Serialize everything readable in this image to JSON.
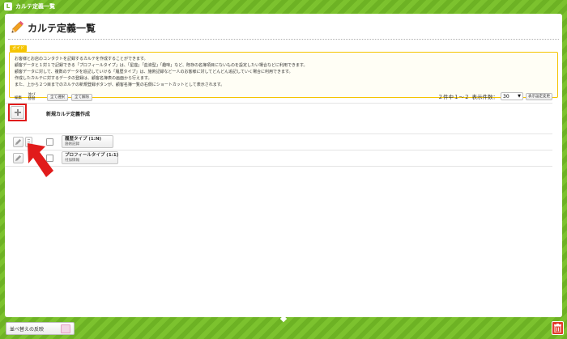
{
  "window": {
    "title": "カルテ定義一覧"
  },
  "page": {
    "title": "カルテ定義一覧"
  },
  "guide": {
    "tag": "ガイド",
    "lines": [
      "お客様とお店のコンタクトを記録するカルテを作成することができます。",
      "顧客データと１対１で記録できる「プロフィールタイプ」は、「星座」「血液型」「趣味」など、既存の名簿項目にないものを設定したい場合などに利用できます。",
      "顧客データに対して、複数のデータを追記していける「履歴タイプ」は、施術記録など一人のお客様に対してどんどん追記していく場合に利用できます。",
      "作成したカルテに対するデータの登録は、顧客名簿表の画面から行えます。",
      "また、上から２つ目までのカルテの新規登録ボタンが、顧客名簿一覧の右側にショートカットとして表示されます。"
    ]
  },
  "table": {
    "col_edit": "編集",
    "col_sort": "並び替替",
    "select_all": "全て選択",
    "deselect_all": "全て解除",
    "paging_text": "２件中１～２",
    "page_size_label": "表示件数：",
    "page_size_value": "30",
    "display_setting": "表示設定変更",
    "new_label": "新規カルテ定義作成",
    "rows": [
      {
        "name": "履歴タイプ (1:N)",
        "sub": "施術記録"
      },
      {
        "name": "プロフィールタイプ (1:1)",
        "sub": "付加情報"
      }
    ]
  },
  "footer": {
    "sort_label": "並べ替えの反映"
  },
  "colors": {
    "brand_green": "#7cc22e",
    "guide_yellow": "#f5c400",
    "highlight_red": "#e11b1b"
  }
}
